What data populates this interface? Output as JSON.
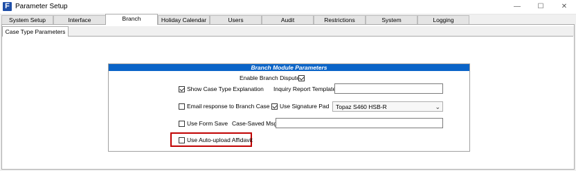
{
  "window": {
    "title": "Parameter Setup",
    "icon_letter": "F",
    "minimize_glyph": "—",
    "maximize_glyph": "☐",
    "close_glyph": "✕"
  },
  "tabs": [
    {
      "label": "System Setup",
      "active": false
    },
    {
      "label": "Interface",
      "active": false
    },
    {
      "label": "Branch",
      "active": true
    },
    {
      "label": "Holiday Calendar",
      "active": false
    },
    {
      "label": "Users",
      "active": false
    },
    {
      "label": "Audit",
      "active": false
    },
    {
      "label": "Restrictions",
      "active": false
    },
    {
      "label": "System",
      "active": false
    },
    {
      "label": "Logging",
      "active": false
    }
  ],
  "subtab": {
    "label": "Case Type Parameters"
  },
  "group": {
    "title": "Branch Module Parameters",
    "enable_branch_dispute": {
      "label": "Enable Branch Dispute",
      "checked": true
    },
    "show_case_type_explanation": {
      "label": "Show Case Type Explanation",
      "checked": true
    },
    "inquiry_report_template": {
      "label": "Inquiry Report Template",
      "value": ""
    },
    "email_response": {
      "label": "Email response to Branch Case",
      "checked": false
    },
    "use_signature_pad": {
      "label": "Use Signature Pad",
      "checked": true
    },
    "signature_pad_select": {
      "value": "Topaz S460 HSB-R"
    },
    "use_form_save": {
      "label": "Use Form Save",
      "checked": false
    },
    "case_saved_msg": {
      "label": "Case-Saved Msg",
      "value": ""
    },
    "use_auto_upload_affidavit": {
      "label": "Use Auto-upload Affidavit",
      "checked": false
    }
  },
  "colors": {
    "group_header_bg": "#0a64c8",
    "highlight_border": "#c00000"
  }
}
